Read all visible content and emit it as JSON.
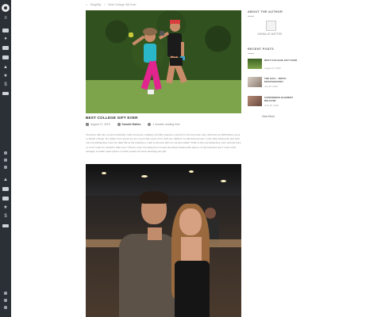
{
  "breadcrumb": {
    "home_icon": "home-icon",
    "section": "Blog/Byl",
    "current": "Best College Gift Ever"
  },
  "sidebar": {
    "icons": [
      "menu-icon",
      "folder-icon",
      "user-icon",
      "trophy-icon",
      "document-icon",
      "triangle-icon",
      "star-icon",
      "dollar-icon",
      "card-icon",
      "facebook-icon",
      "twitter-icon",
      "instagram-icon",
      "triangle-icon",
      "document-icon",
      "mail-icon",
      "star-icon",
      "dollar-icon",
      "card-icon",
      "facebook-icon",
      "twitter-icon",
      "instagram-icon"
    ]
  },
  "post": {
    "title": "BEST COLLEGE GIFT EVER",
    "date": "August 17, 2019",
    "author": "Kanalle Mattes",
    "reading_time": "1 minutes reading time",
    "excerpt": "We knew that day would eventually come; however, nothing can fully prepare a parent for the day their only child moves 2000 miles away to attend college. No matter how proud we are to provide a part of us with our children would invest hours, to the help them pack and pick out everything they want for their life in the residence, what is the best gift we can give them? What is the one thing they were already have or won't want in a month's time now? There's only one thing that crossed my mind: memorable photos of my husband and I cause what teenager wouldn't need photos of their parents for their morning-out gift."
  },
  "sidebar_right": {
    "about_heading": "ABOUT THE AUTHOR",
    "author_name": "KANALLE MATTES",
    "recent_heading": "RECENT POSTS",
    "recent": [
      {
        "title": "BEST COLLEGE GIFT EVER",
        "date": "August 17, 2019"
      },
      {
        "title": "THE HALL - BIRTH PHOTOGRAPHY",
        "date": "July 26, 2019"
      },
      {
        "title": "CONFIDENCE ELEMENT RELEASE",
        "date": "June 15, 2019"
      }
    ],
    "view_more": "View More"
  }
}
